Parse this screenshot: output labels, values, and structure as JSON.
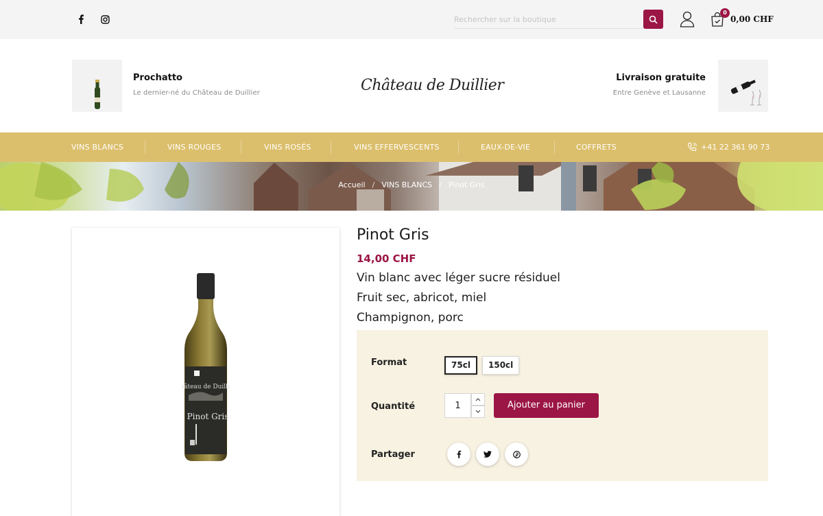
{
  "topbar": {
    "social": [
      {
        "name": "facebook-icon"
      },
      {
        "name": "instagram-icon"
      }
    ],
    "search_placeholder": "Rechercher sur la boutique",
    "cart_count": "0",
    "cart_total": "0,00 CHF",
    "accent_color": "#9b1545"
  },
  "header": {
    "left_promo": {
      "title": "Prochatto",
      "subtitle": "Le dernier-né du Château de Duillier"
    },
    "logo_text": "Château de Duillier",
    "right_promo": {
      "title": "Livraison gratuite",
      "subtitle": "Entre Genève et Lausanne"
    }
  },
  "nav": {
    "items": [
      "VINS BLANCS",
      "VINS ROUGES",
      "VINS ROSÉS",
      "VINS EFFERVESCENTS",
      "EAUX-DE-VIE",
      "COFFRETS"
    ],
    "phone": "+41 22 361 90 73",
    "color": "#dcbf6c"
  },
  "breadcrumb": {
    "items": [
      "Accueil",
      "VINS BLANCS",
      "Pinot Gris"
    ],
    "separator": "/"
  },
  "product": {
    "title": "Pinot Gris",
    "price": "14,00 CHF",
    "description_lines": [
      "Vin blanc avec léger sucre résiduel",
      "Fruit sec, abricot, miel",
      "Champignon, porc"
    ],
    "bottle_label_brand": "Château de Duillier",
    "bottle_label_name": "Pinot Gris"
  },
  "options": {
    "format_label": "Format",
    "formats": [
      "75cl",
      "150cl"
    ],
    "selected_format": "75cl",
    "quantity_label": "Quantité",
    "quantity_value": "1",
    "add_to_cart_label": "Ajouter au panier",
    "share_label": "Partager",
    "share_icons": [
      "facebook-icon",
      "twitter-icon",
      "pinterest-icon"
    ],
    "box_color": "#f8f2e2"
  }
}
